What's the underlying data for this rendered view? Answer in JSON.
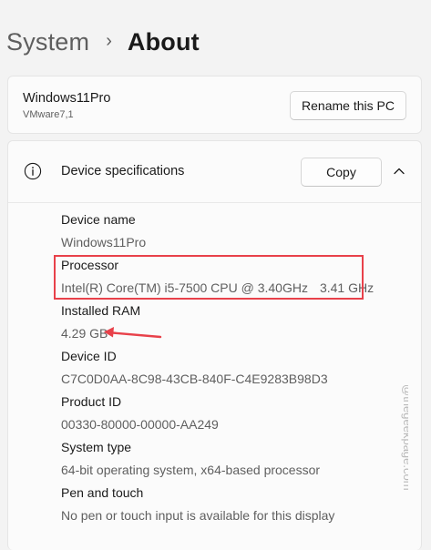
{
  "breadcrumb": {
    "parent": "System",
    "separator": "›",
    "current": "About"
  },
  "pc": {
    "name": "Windows11Pro",
    "model": "VMware7,1",
    "rename_label": "Rename this PC"
  },
  "device_specs": {
    "title": "Device specifications",
    "copy_label": "Copy",
    "items": [
      {
        "label": "Device name",
        "value": "Windows11Pro"
      },
      {
        "label": "Processor",
        "value": "Intel(R) Core(TM) i5-7500 CPU @ 3.40GHz",
        "value_extra": "3.41 GHz"
      },
      {
        "label": "Installed RAM",
        "value": "4.29 GB"
      },
      {
        "label": "Device ID",
        "value": "C7C0D0AA-8C98-43CB-840F-C4E9283B98D3"
      },
      {
        "label": "Product ID",
        "value": "00330-80000-00000-AA249"
      },
      {
        "label": "System type",
        "value": "64-bit operating system, x64-based processor"
      },
      {
        "label": "Pen and touch",
        "value": "No pen or touch input is available for this display"
      }
    ]
  },
  "annotations": {
    "highlight_color": "#e8414a",
    "arrow_color": "#e8414a"
  },
  "watermark": {
    "text": "@thegeekpage.com"
  },
  "icons": {
    "info": "info-icon",
    "chevron": "chevron-up-icon",
    "breadcrumb_separator": "chevron-right-icon"
  }
}
